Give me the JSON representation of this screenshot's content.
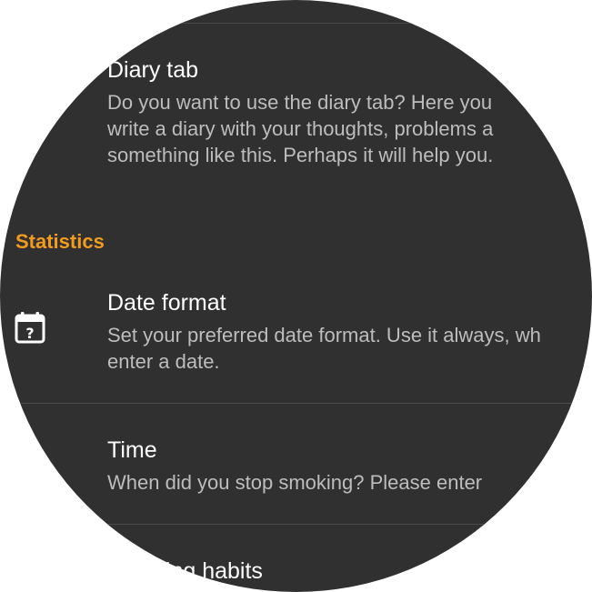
{
  "preferences": {
    "diary_tab": {
      "title": "Diary tab",
      "summary": "Do you want to use the diary tab? Here you\nwrite a diary with your thoughts, problems a\nsomething like this. Perhaps it will help you."
    },
    "statistics_header": "Statistics",
    "date_format": {
      "icon": "calendar-question-icon",
      "title": "Date format",
      "summary": "Set your preferred date format. Use it always, wh\nenter a date."
    },
    "time": {
      "title": "Time",
      "summary": "When did you stop smoking? Please enter"
    },
    "habits": {
      "title": "Smoking habits"
    }
  },
  "colors": {
    "background": "#303030",
    "accent": "#f29c1f",
    "title_text": "#ffffff",
    "summary_text": "#bdbdbd"
  }
}
